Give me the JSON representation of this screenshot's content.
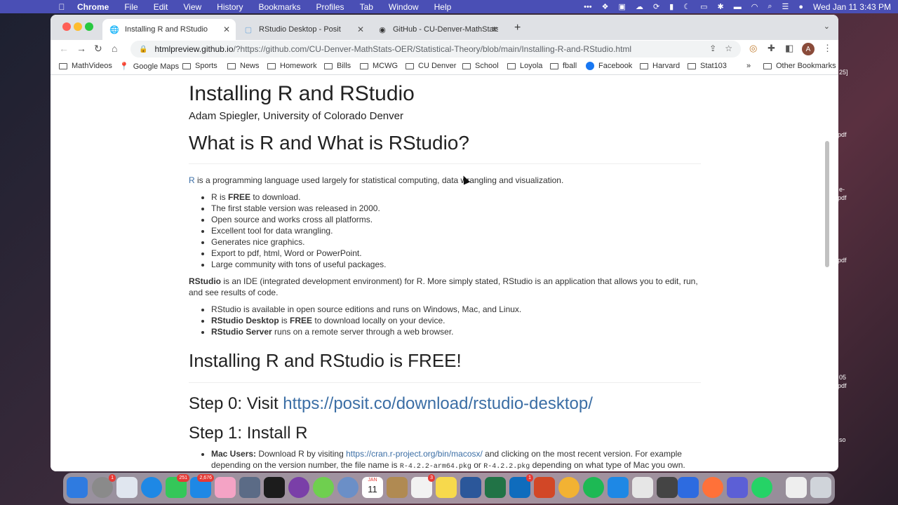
{
  "menubar": {
    "app": "Chrome",
    "items": [
      "File",
      "Edit",
      "View",
      "History",
      "Bookmarks",
      "Profiles",
      "Tab",
      "Window",
      "Help"
    ],
    "clock": "Wed Jan 11  3:43 PM"
  },
  "tabs": [
    {
      "title": "Installing R and RStudio",
      "active": true
    },
    {
      "title": "RStudio Desktop - Posit",
      "active": false
    },
    {
      "title": "GitHub - CU-Denver-MathStats",
      "active": false
    }
  ],
  "address": {
    "host": "htmlpreview.github.io",
    "path": "/?https://github.com/CU-Denver-MathStats-OER/Statistical-Theory/blob/main/Installing-R-and-RStudio.html"
  },
  "profile_initial": "A",
  "bookmarks": [
    "MathVideos",
    "Google Maps",
    "Sports",
    "News",
    "Homework",
    "Bills",
    "MCWG",
    "CU Denver",
    "School",
    "Loyola",
    "fball",
    "Facebook",
    "Harvard",
    "Stat103"
  ],
  "bookmarks_more": "»",
  "other_bookmarks": "Other Bookmarks",
  "page": {
    "title": "Installing R and RStudio",
    "author": "Adam Spiegler, University of Colorado Denver",
    "h_what": "What is R and What is RStudio?",
    "r_link": "R",
    "r_intro": " is a programming language used largely for statistical computing, data wrangling and visualization.",
    "r_free_pre": "R is ",
    "r_free_bold": "FREE",
    "r_free_post": " to download.",
    "r_bullets": [
      "The first stable version was released in 2000.",
      "Open source and works cross all platforms.",
      "Excellent tool for data wrangling.",
      "Generates nice graphics.",
      "Export to pdf, html, Word or PowerPoint.",
      "Large community with tons of useful packages."
    ],
    "rstudio_bold": "RStudio",
    "rstudio_intro": " is an IDE (integrated development environment) for R. More simply stated, RStudio is an application that allows you to edit, run, and see results of code.",
    "rs_b1": "RStudio is available in open source editions and runs on Windows, Mac, and Linux.",
    "rs_b2_bold": "RStudio Desktop",
    "rs_b2_mid": " is ",
    "rs_b2_free": "FREE",
    "rs_b2_post": " to download locally on your device.",
    "rs_b3_bold": "RStudio Server",
    "rs_b3_post": " runs on a remote server through a web browser.",
    "h_free": "Installing R and RStudio is FREE!",
    "h_step0_pre": "Step 0: Visit ",
    "h_step0_link": "https://posit.co/download/rstudio-desktop/",
    "h_step1": "Step 1: Install R",
    "mac_bold": "Mac Users:",
    "mac_pre": " Download R by visiting ",
    "mac_link": "https://cran.r-project.org/bin/macosx/",
    "mac_post": " and clicking on the most recent version. For example depending on the version number, the file name is ",
    "mac_code1": "R-4.2.2-arm64.pkg",
    "mac_or": " or ",
    "mac_code2": "R-4.2.2.pkg",
    "mac_end": " depending on what type of Mac you own."
  },
  "desktop_labels": [
    "25]",
    "pdf",
    "e-",
    "pdf",
    "pdf",
    "05",
    "pdf",
    "so"
  ],
  "dock_date": {
    "month": "JAN",
    "day": "11"
  },
  "dock_badges": [
    "1",
    "251",
    "2,676",
    "3",
    "1"
  ],
  "colors": {
    "menubar": "#4a4fb5",
    "link": "#3b6ea5",
    "tabbar": "#dfe1e5"
  }
}
